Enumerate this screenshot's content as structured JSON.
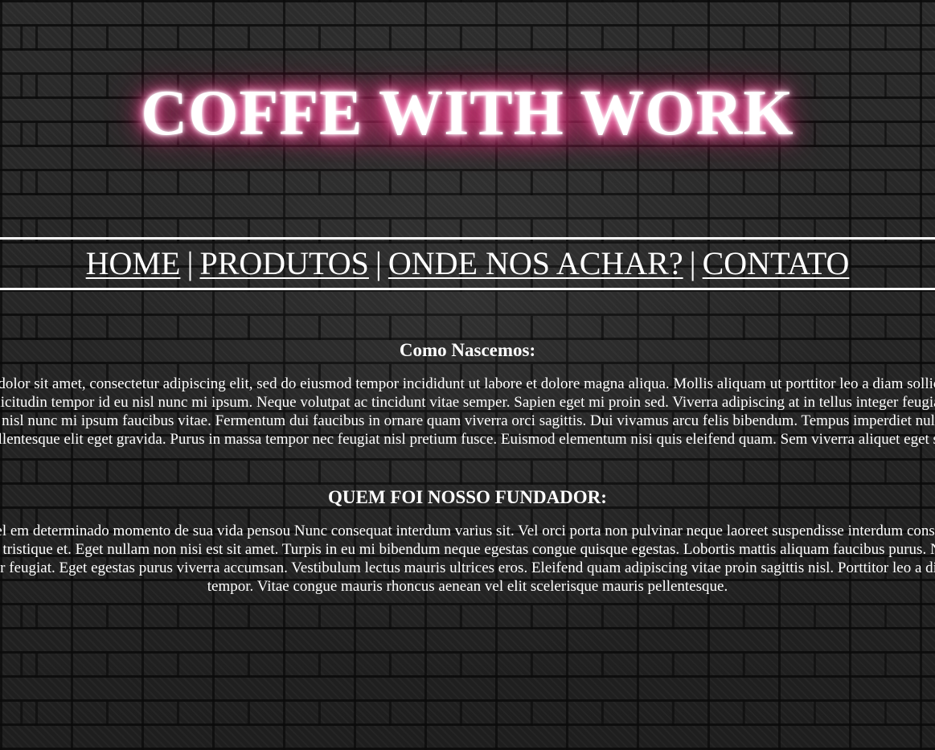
{
  "header": {
    "title": "COFFE WITH WORK"
  },
  "nav": {
    "items": [
      {
        "label": "HOME"
      },
      {
        "label": "PRODUTOS"
      },
      {
        "label": "ONDE NOS ACHAR?"
      },
      {
        "label": "CONTATO"
      }
    ],
    "separator": "|"
  },
  "sections": [
    {
      "title": "Como Nascemos:",
      "text": "Lorem ipsum dolor sit amet, consectetur adipiscing elit, sed do eiusmod tempor incididunt ut labore et dolore magna aliqua. Mollis aliquam ut porttitor leo a diam sollicitudin tempor id. A diam sollicitudin tempor id eu nisl nunc mi ipsum. Neque volutpat ac tincidunt vitae semper. Sapien eget mi proin sed. Viverra adipiscing at in tellus integer feugiat. Sollicitudin tempor id eu nisl nunc mi ipsum faucibus vitae. Fermentum dui faucibus in ornare quam viverra orci sagittis. Dui vivamus arcu felis bibendum. Tempus imperdiet nulla malesuada pellentesque elit eget gravida. Purus in massa tempor nec feugiat nisl pretium fusce. Euismod elementum nisi quis eleifend quam. Sem viverra aliquet eget sit."
    },
    {
      "title": "QUEM FOI NOSSO FUNDADOR:",
      "text": "Paulo Samuel em determinado momento de sua vida pensou Nunc consequat interdum varius sit. Vel orci porta non pulvinar neque laoreet suspendisse interdum consectetur. Felis bibendum ut tristique et. Eget nullam non nisi est sit amet. Turpis in eu mi bibendum neque egestas congue quisque egestas. Lobortis mattis aliquam faucibus purus. Nec tincidunt praesent semper feugiat. Eget egestas purus viverra accumsan. Vestibulum lectus mauris ultrices eros. Eleifend quam adipiscing vitae proin sagittis nisl. Porttitor leo a diam sollicitudin tempor. Vitae congue mauris rhoncus aenean vel elit scelerisque mauris pellentesque."
    }
  ]
}
